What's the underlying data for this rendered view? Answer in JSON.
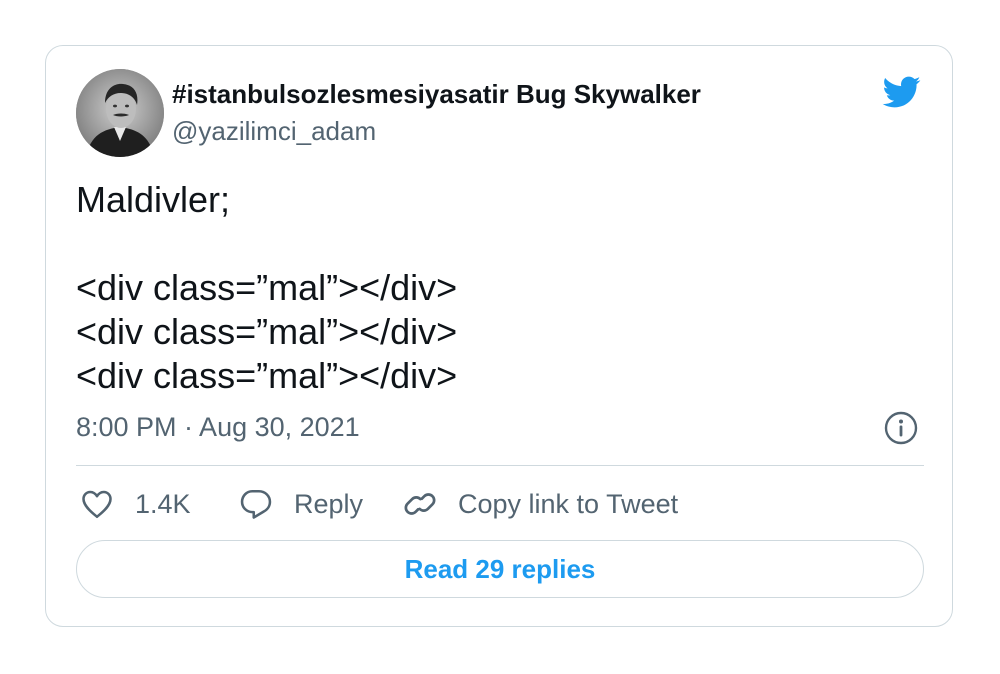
{
  "author": {
    "display_name": "#istanbulsozlesmesiyasatir Bug Skywalker",
    "handle": "@yazilimci_adam"
  },
  "tweet": {
    "lines": [
      "Maldivler;",
      "",
      "<div class=”mal”></div>",
      "<div class=”mal”></div>",
      "<div class=”mal”></div>"
    ],
    "timestamp": "8:00 PM · Aug 30, 2021"
  },
  "actions": {
    "like_count": "1.4K",
    "reply_label": "Reply",
    "copy_link_label": "Copy link to Tweet"
  },
  "read_replies_label": "Read 29 replies",
  "icons": {
    "brand": "twitter-bird-icon",
    "info": "info-icon",
    "like": "heart-icon",
    "reply": "speech-bubble-icon",
    "copy": "link-icon"
  },
  "colors": {
    "brand": "#1d9bf0",
    "text_primary": "#0f1419",
    "text_secondary": "#536471",
    "border": "#cfd9de"
  }
}
